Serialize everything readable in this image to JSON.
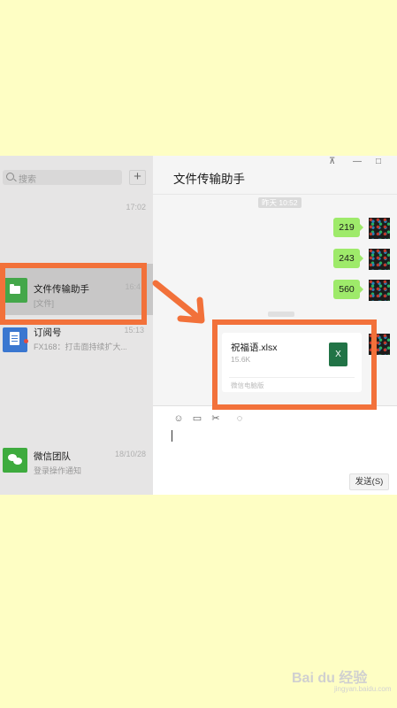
{
  "sidebar": {
    "search_placeholder": "搜索",
    "add_label": "+",
    "items": [
      {
        "name": "",
        "preview": "",
        "time": "17:02"
      },
      {
        "name": "文件传输助手",
        "preview": "[文件]",
        "time": "16:4"
      },
      {
        "name": "订阅号",
        "preview": "FX168：打击面持续扩大...",
        "time": "15:13"
      },
      {
        "name": "微信团队",
        "preview": "登录操作通知",
        "time": "18/10/28"
      }
    ]
  },
  "chat": {
    "title": "文件传输助手",
    "time_separator": "昨天 10:52",
    "messages": [
      "219",
      "243",
      "560"
    ],
    "file": {
      "name": "祝福语.xlsx",
      "size": "15.6K",
      "source": "微信电脑版",
      "type_letter": "X"
    },
    "send_label": "发送(S)"
  },
  "window": {
    "pin": "⊼",
    "minimize": "—",
    "maximize": "□"
  },
  "toolbar": {
    "emoji": "☺",
    "folder": "▭",
    "scissors": "✂",
    "chat": "◌"
  },
  "watermark": {
    "brand": "Bai du 经验",
    "sub": "jingyan.baidu.com"
  },
  "annotation_color": "#f2713a"
}
